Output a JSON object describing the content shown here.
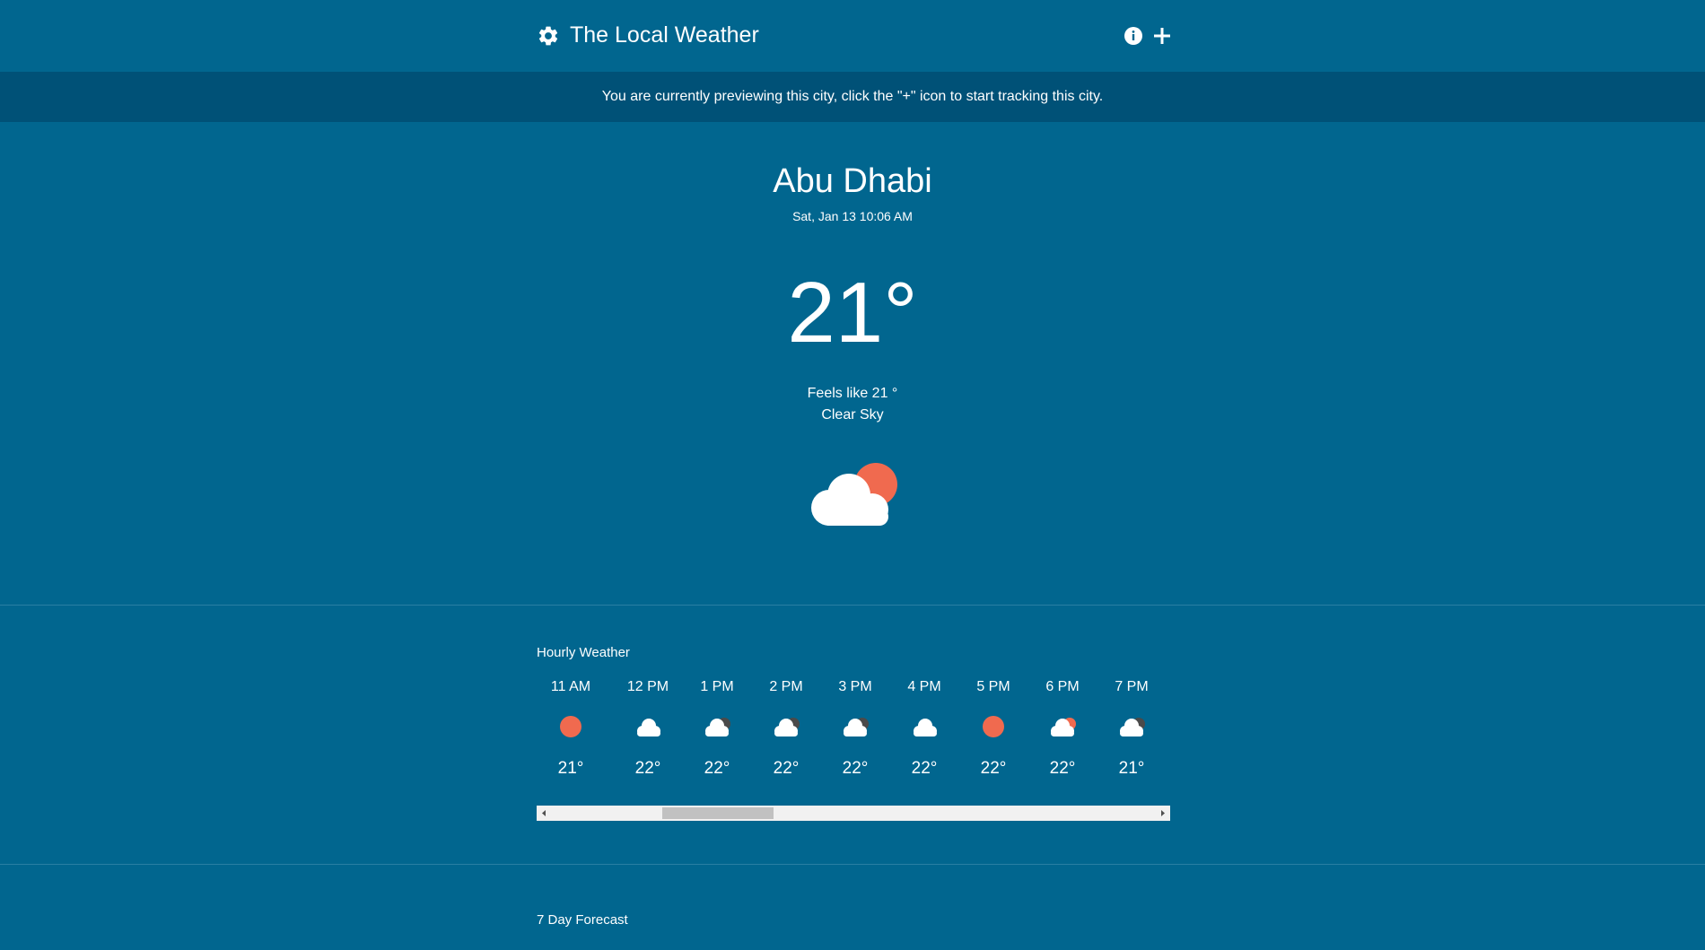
{
  "header": {
    "title": "The Local Weather",
    "settings_icon": "gear-icon",
    "info_icon": "info-icon",
    "add_icon": "plus-icon"
  },
  "banner": {
    "text": "You are currently previewing this city, click the \"+\" icon to start tracking this city."
  },
  "current": {
    "city": "Abu Dhabi",
    "datetime": "Sat, Jan 13 10:06 AM",
    "temperature": "21°",
    "feels_like": "Feels like 21 °",
    "condition": "Clear Sky",
    "icon": "partly-cloudy-day-icon"
  },
  "hourly": {
    "title": "Hourly Weather",
    "items": [
      {
        "time": "11 AM",
        "icon": "sun-icon",
        "temp": "21°"
      },
      {
        "time": "12 PM",
        "icon": "cloud-icon",
        "temp": "22°"
      },
      {
        "time": "1 PM",
        "icon": "cloud-moon-icon",
        "temp": "22°"
      },
      {
        "time": "2 PM",
        "icon": "cloud-moon-icon",
        "temp": "22°"
      },
      {
        "time": "3 PM",
        "icon": "cloud-moon-icon",
        "temp": "22°"
      },
      {
        "time": "4 PM",
        "icon": "cloud-icon",
        "temp": "22°"
      },
      {
        "time": "5 PM",
        "icon": "sun-icon",
        "temp": "22°"
      },
      {
        "time": "6 PM",
        "icon": "cloud-sun-icon",
        "temp": "22°"
      },
      {
        "time": "7 PM",
        "icon": "cloud-moon-icon",
        "temp": "21°"
      }
    ]
  },
  "forecast": {
    "title": "7 Day Forecast"
  },
  "colors": {
    "background": "#01668f",
    "banner": "#005177",
    "sun": "#f06a4f",
    "cloud": "#ffffff",
    "moon": "#4a4a4a"
  }
}
